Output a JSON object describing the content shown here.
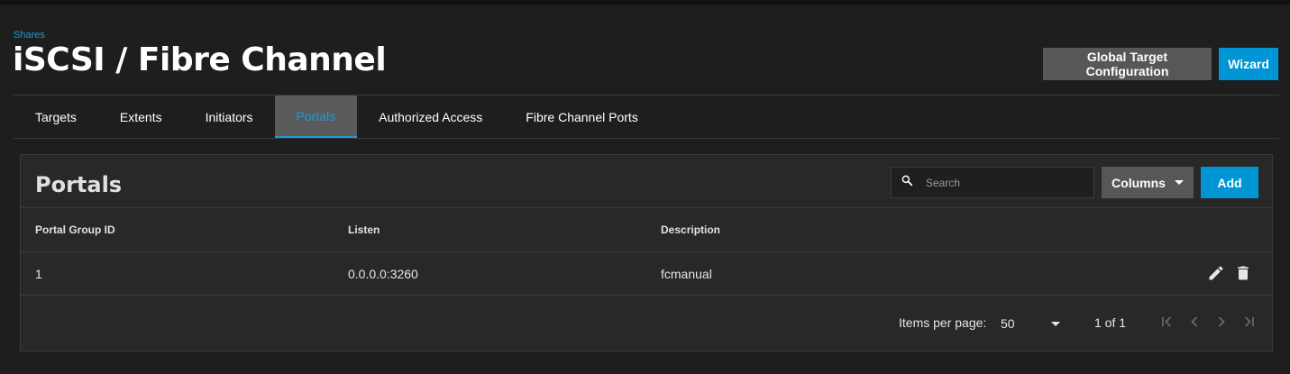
{
  "breadcrumb": "Shares",
  "page_title": "iSCSI / Fibre Channel",
  "header_buttons": {
    "global_target_config": "Global Target Configuration",
    "wizard": "Wizard"
  },
  "tabs": [
    {
      "label": "Targets",
      "active": false
    },
    {
      "label": "Extents",
      "active": false
    },
    {
      "label": "Initiators",
      "active": false
    },
    {
      "label": "Portals",
      "active": true
    },
    {
      "label": "Authorized Access",
      "active": false
    },
    {
      "label": "Fibre Channel Ports",
      "active": false
    }
  ],
  "card": {
    "title": "Portals",
    "search": {
      "placeholder": "Search",
      "value": ""
    },
    "columns_label": "Columns",
    "add_label": "Add"
  },
  "table": {
    "columns": [
      "Portal Group ID",
      "Listen",
      "Description"
    ],
    "rows": [
      {
        "portal_group_id": "1",
        "listen": "0.0.0.0:3260",
        "description": "fcmanual"
      }
    ]
  },
  "paginator": {
    "items_per_page_label": "Items per page:",
    "page_size": "50",
    "range": "1 of 1"
  },
  "icons": {
    "search": "search-icon",
    "edit": "pencil-icon",
    "delete": "trash-icon",
    "first": "first-page-icon",
    "prev": "chevron-left-icon",
    "next": "chevron-right-icon",
    "last": "last-page-icon"
  },
  "colors": {
    "accent": "#0095d5",
    "link": "#1e9bd7",
    "background": "#1e1e1e",
    "card": "#282828",
    "button_secondary": "#575757"
  }
}
